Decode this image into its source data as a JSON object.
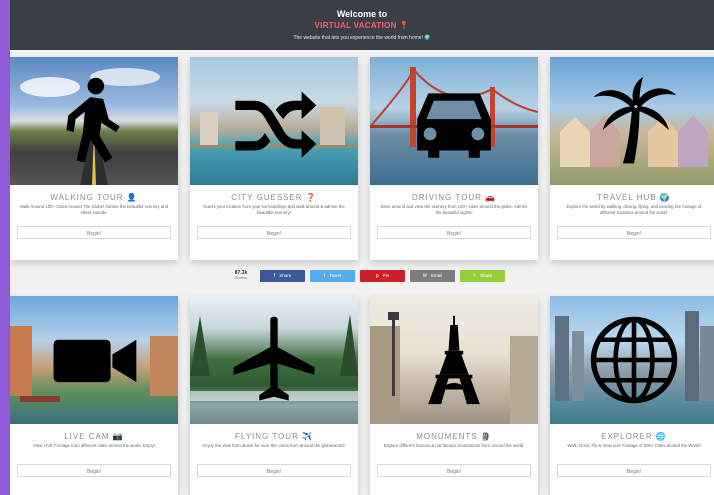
{
  "header": {
    "welcome": "Welcome to",
    "site_title": "VIRTUAL VACATION 📍",
    "tagline": "The website that lets you experience the world from home! 🌍"
  },
  "cards": [
    {
      "title": "WALKING TOUR 👤",
      "description": "Walk Around 100+ Cities Around The Globe! Admire the beautiful scenery and street sounds.",
      "button": "Begin!",
      "icon": "walking-person-icon",
      "scene": "road-landscape"
    },
    {
      "title": "CITY GUESSER ❓",
      "description": "Guess your location from your surroundings and walk around & admire the beautiful scenery!",
      "button": "Begin!",
      "icon": "shuffle-icon",
      "scene": "waterfront-city"
    },
    {
      "title": "DRIVING TOUR 🚗",
      "description": "Drive around and view the scenery from 100+ cities around the globe. Admire the beautiful sights!",
      "button": "Begin!",
      "icon": "car-icon",
      "scene": "golden-gate-bridge"
    },
    {
      "title": "TRAVEL HUB 🌍",
      "description": "Explore the world by walking, driving, flying, and viewing live footage of different locations around the world.",
      "button": "Begin!",
      "icon": "palm-tree-icon",
      "scene": "painted-houses"
    },
    {
      "title": "LIVE CAM 📷",
      "description": "View LIVE Footage from different cities around the world. Enjoy!",
      "button": "Begin!",
      "icon": "video-camera-icon",
      "scene": "canal-city"
    },
    {
      "title": "FLYING TOUR ✈️",
      "description": "Enjoy the view from above for over 90+ cities from around the globe/world!",
      "button": "Begin!",
      "icon": "airplane-icon",
      "scene": "forest-river"
    },
    {
      "title": "MONUMENTS 🗿",
      "description": "Explore different famous & not famous monuments from around the world.",
      "button": "Begin!",
      "icon": "eiffel-tower-icon",
      "scene": "paris-street"
    },
    {
      "title": "EXPLORER 🌐",
      "description": "Walk, Drive, Fly & View Live Footage of 500+ Cities around the World!",
      "button": "Begin!",
      "icon": "globe-icon",
      "scene": "skyline-river"
    }
  ],
  "share": {
    "count": "87.3k",
    "count_label": "Shares",
    "buttons": [
      {
        "label": "Share",
        "network": "facebook",
        "color": "#3b5998",
        "glyph": "f"
      },
      {
        "label": "Tweet",
        "network": "twitter",
        "color": "#55acee",
        "glyph": "t"
      },
      {
        "label": "Pin",
        "network": "pinterest",
        "color": "#cb2027",
        "glyph": "p"
      },
      {
        "label": "Email",
        "network": "email",
        "color": "#7d7d7d",
        "glyph": "✉"
      },
      {
        "label": "Share",
        "network": "sharethis",
        "color": "#95d03a",
        "glyph": "<"
      }
    ]
  }
}
